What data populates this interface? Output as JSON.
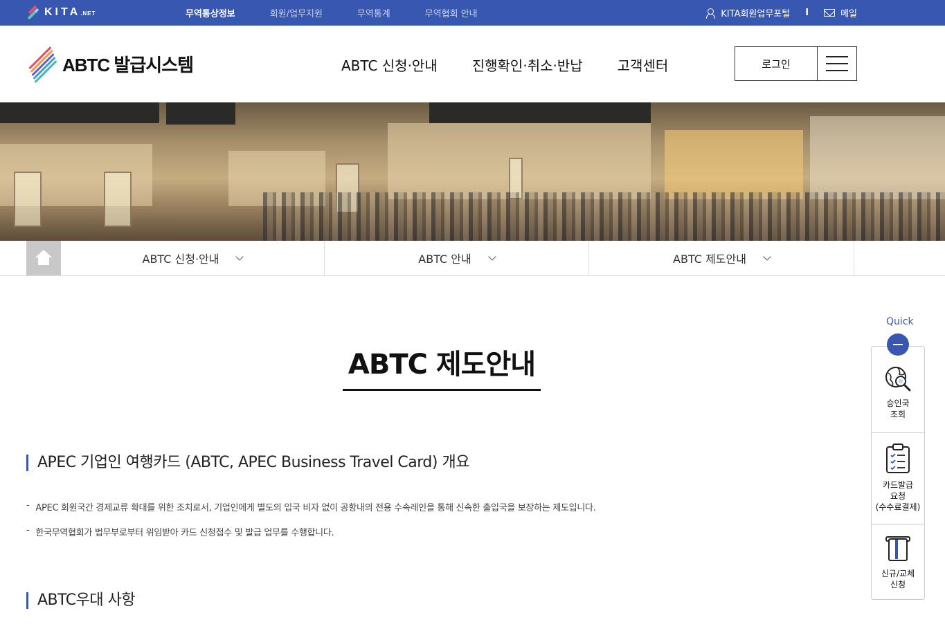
{
  "topbar": {
    "logo_main": "KITA",
    "logo_sub": ".NET",
    "nav": [
      "무역통상정보",
      "회원/업무지원",
      "무역통계",
      "무역협회 안내"
    ],
    "active_index": 0,
    "portal_label": "KITA회원업무포털",
    "separator": "I",
    "mail_label": "메일",
    "color": "#3757b0"
  },
  "header": {
    "brand_name": "ABTC 발급시스템",
    "gnb": [
      "ABTC 신청·안내",
      "진행확인·취소·반납",
      "고객센터"
    ],
    "login_label": "로그인"
  },
  "subnav": {
    "items": [
      "ABTC 신청·안내",
      "ABTC 안내",
      "ABTC 제도안내"
    ]
  },
  "main": {
    "page_title": "ABTC 제도안내",
    "sections": [
      {
        "title": "APEC 기업인 여행카드 (ABTC, APEC Business Travel Card) 개요",
        "bullets": [
          "APEC 회원국간 경제교류 확대를 위한 조치로서, 기업인에게 별도의 입국 비자 없이 공항내의 전용 수속레인을 통해 신속한 출입국을 보장하는 제도입니다.",
          "한국무역협회가 법무부로부터 위임받아 카드 신청접수 및 발급 업무를 수행합니다."
        ]
      },
      {
        "title": "ABTC우대 사항",
        "bullets": []
      }
    ],
    "bullet_marker": "-"
  },
  "quick": {
    "label": "Quick",
    "items": [
      {
        "icon": "globe-search-icon",
        "lines": [
          "승인국",
          "조회"
        ]
      },
      {
        "icon": "clipboard-checklist-icon",
        "lines": [
          "카드발급",
          "요청",
          "(수수료결제)"
        ]
      },
      {
        "icon": "card-icon",
        "lines": [
          "신규/교체",
          "신청"
        ]
      }
    ]
  }
}
